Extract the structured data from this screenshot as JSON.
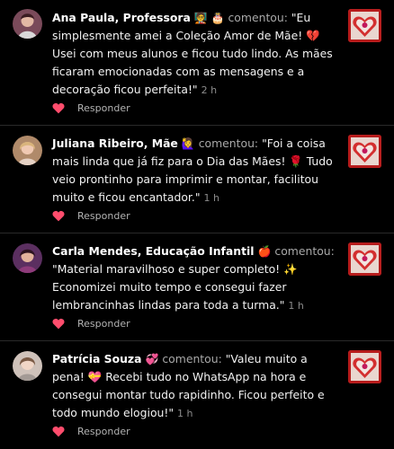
{
  "comments": [
    {
      "author": "Ana Paula, Professora",
      "author_emojis": "🧑‍🏫 🎂",
      "verb": "comentou:",
      "text": "\"Eu simplesmente amei a Coleção Amor de Mãe! 💔 Usei com meus alunos e ficou tudo lindo. As mães ficaram emocionadas com as mensagens e a decoração ficou perfeita!\"",
      "time": "2 h",
      "reply_label": "Responder",
      "avatar_icon": "profile-photo-woman-dark-hair",
      "thumb_icon": "mothers-day-heart-card",
      "colors": {
        "avatar": "#8a5a6b",
        "thumb": "#c62828"
      }
    },
    {
      "author": "Juliana Ribeiro, Mãe",
      "author_emojis": "🙋‍♀️",
      "verb": "comentou:",
      "text": "\"Foi a coisa mais linda que já fiz para o Dia das Mães! 🌹 Tudo veio prontinho para imprimir e montar, facilitou muito e ficou encantador.\"",
      "time": "1 h",
      "reply_label": "Responder",
      "avatar_icon": "profile-photo-woman-blonde",
      "thumb_icon": "mothers-day-heart-card",
      "colors": {
        "avatar": "#c9a27e",
        "thumb": "#c62828"
      }
    },
    {
      "author": "Carla Mendes, Educação Infantil",
      "author_emojis": "🍎",
      "verb": "comentou:",
      "text": "\"Material maravilhoso e super completo! ✨ Economizei muito tempo e consegui fazer lembrancinhas lindas para toda a turma.\"",
      "time": "1 h",
      "reply_label": "Responder",
      "avatar_icon": "profile-photo-woman-purple",
      "thumb_icon": "mothers-day-heart-card",
      "colors": {
        "avatar": "#6b3c6e",
        "thumb": "#c62828"
      }
    },
    {
      "author": "Patrícia Souza",
      "author_emojis": "💞",
      "verb": "comentou:",
      "text": "\"Valeu muito a pena! 💝 Recebi tudo no WhatsApp na hora e consegui montar tudo rapidinho. Ficou perfeito e todo mundo elogiou!\"",
      "time": "1 h",
      "reply_label": "Responder",
      "avatar_icon": "profile-photo-woman-light",
      "thumb_icon": "mothers-day-heart-card",
      "colors": {
        "avatar": "#d8c9c0",
        "thumb": "#c62828"
      }
    }
  ],
  "theme": {
    "background": "#000000",
    "like_heart": "#ff4d6d"
  }
}
